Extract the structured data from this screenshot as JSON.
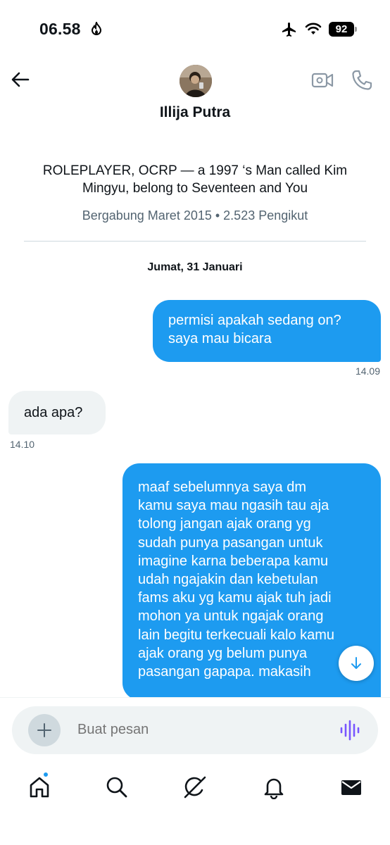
{
  "status_bar": {
    "time": "06.58",
    "battery": "92"
  },
  "header": {
    "name": "Illija Putra"
  },
  "profile": {
    "bio_line1": "ROLEPLAYER, OCRP — a 1997 ‘s Man called Kim",
    "bio_line2": "Mingyu, belong to Seventeen and You",
    "meta": "Bergabung Maret 2015 • 2.523 Pengikut"
  },
  "conversation": {
    "date_separator": "Jumat, 31 Januari",
    "messages": [
      {
        "direction": "sent",
        "lines": [
          "permisi apakah sedang on?",
          "saya mau bicara"
        ],
        "time": "14.09"
      },
      {
        "direction": "received",
        "lines": [
          "ada apa?"
        ],
        "time": "14.10"
      },
      {
        "direction": "sent",
        "lines": [
          "maaf sebelumnya saya dm",
          "kamu saya mau ngasih tau aja",
          "tolong jangan ajak orang yg",
          "sudah punya pasangan untuk",
          "imagine karna beberapa kamu",
          "udah ngajakin dan kebetulan",
          "fams aku yg kamu ajak tuh jadi",
          "mohon ya untuk ngajak orang",
          "lain begitu terkecuali kalo kamu",
          "ajak orang yg belum punya",
          "pasangan gapapa. makasih"
        ]
      }
    ]
  },
  "composer": {
    "placeholder": "Buat pesan"
  },
  "nav": {
    "items": [
      "home-icon",
      "search-icon",
      "grok-icon",
      "notifications-icon",
      "messages-icon"
    ]
  },
  "colors": {
    "accent": "#1d9bf0",
    "bubble_received": "#eff3f4",
    "voice_icon": "#7856ff"
  }
}
